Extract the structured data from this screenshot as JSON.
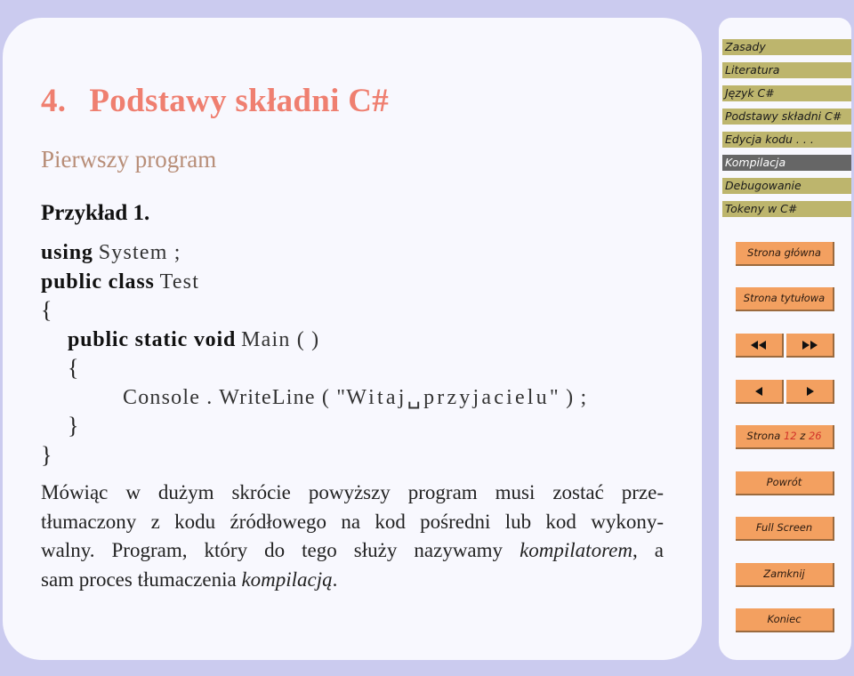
{
  "slide": {
    "section_number": "4.",
    "section_title": "Podstawy składni C#",
    "subtitle": "Pierwszy program",
    "example_label": "Przykład 1.",
    "code": {
      "line1_kw": "using",
      "line1_rest": "System ;",
      "line2_kw": "public class",
      "line2_rest": "Test",
      "open_brace": "{",
      "line4_kw": "public static void",
      "line4_rest": "Main ( )",
      "line6_call": "Console . WriteLine ( \"",
      "line6_str": "Witaj␣przyjacielu",
      "line6_end": "\" ) ;",
      "close_brace": "}"
    },
    "paragraph": {
      "line1": "Mówiąc w dużym skrócie powyższy program musi zostać prze-",
      "line2": "tłumaczony z kodu źródłowego na kod pośredni lub kod wykony-",
      "line3_a": "walny. Program, który do tego służy nazywamy ",
      "line3_em": "kompilatorem",
      "line3_b": ", a",
      "line4_a": "sam proces tłumaczenia ",
      "line4_em": "kompilacją",
      "line4_b": "."
    }
  },
  "nav": {
    "items": [
      {
        "label": "Zasady",
        "active": false
      },
      {
        "label": "Literatura",
        "active": false
      },
      {
        "label": "Język C#",
        "active": false
      },
      {
        "label": "Podstawy składni C#",
        "active": false
      },
      {
        "label": "Edycja kodu . . .",
        "active": false
      },
      {
        "label": "Kompilacja",
        "active": true
      },
      {
        "label": "Debugowanie",
        "active": false
      },
      {
        "label": "Tokeny w C#",
        "active": false
      }
    ],
    "buttons": {
      "home": "Strona główna",
      "title_page": "Strona tytułowa",
      "page_prefix": "Strona",
      "page_current": "12",
      "page_sep": "z",
      "page_total": "26",
      "back": "Powrót",
      "full_screen": "Full Screen",
      "close": "Zamknij",
      "quit": "Koniec"
    },
    "icons": {
      "first": "double-left-triangle",
      "last": "double-right-triangle",
      "prev": "left-triangle",
      "next": "right-triangle"
    },
    "colors": {
      "item_bg": "#bdb56d",
      "item_active_bg": "#666666",
      "button_bg": "#f3a060",
      "page_number": "#d2332a"
    }
  },
  "colors": {
    "background": "#cbcbef",
    "panel": "#f8f8fe",
    "title": "#ef7f70",
    "subtitle": "#b88e78"
  }
}
